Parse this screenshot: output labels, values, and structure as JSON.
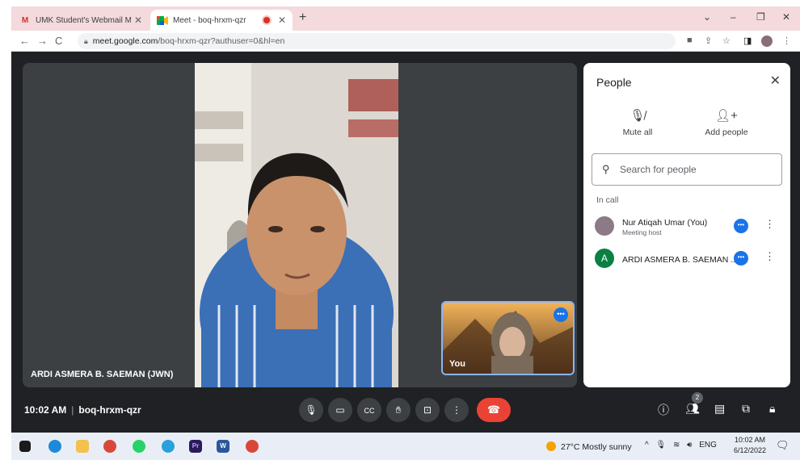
{
  "browser": {
    "tabs": [
      {
        "label": "UMK Student's Webmail Mail",
        "favicon": "gmail-icon"
      },
      {
        "label": "Meet - boq-hrxm-qzr",
        "favicon": "google-meet-icon"
      }
    ],
    "url_host": "meet.google.com",
    "url_path": "/boq-hrxm-qzr?authuser=0&hl=en"
  },
  "stage": {
    "main_tile_name": "ARDI ASMERA B. SAEMAN (JWN)",
    "self_tile_label": "You"
  },
  "people_panel": {
    "title": "People",
    "mute_all_label": "Mute all",
    "add_people_label": "Add people",
    "search_placeholder": "Search for people",
    "section_label": "In call",
    "participants": [
      {
        "name": "Nur Atiqah Umar (You)",
        "role": "Meeting host",
        "avatar": ""
      },
      {
        "name": "ARDI ASMERA B. SAEMAN ...",
        "role": "",
        "avatar": "A"
      }
    ]
  },
  "controls": {
    "time": "10:02 AM",
    "meeting_code": "boq-hrxm-qzr",
    "participant_count": "2"
  },
  "taskbar": {
    "weather": "27°C  Mostly sunny",
    "lang": "ENG",
    "clock_time": "10:02 AM",
    "clock_date": "6/12/2022"
  },
  "colors": {
    "meet_dark": "#202124",
    "tile_bg": "#3c4043",
    "end_call_red": "#ea4335",
    "accent_blue": "#1a73e8"
  }
}
